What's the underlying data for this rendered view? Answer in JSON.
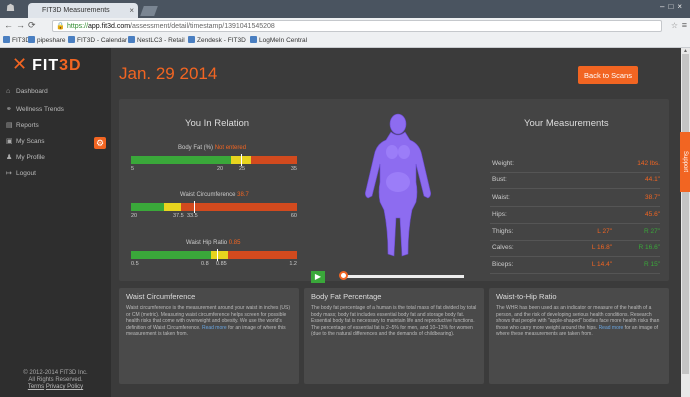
{
  "browser": {
    "tab_title": "FIT3D Measurements",
    "url_scheme": "https://",
    "url_host": "app.fit3d.com",
    "url_path": "/assessment/detail/timestamp/1391041545208",
    "bookmarks": [
      "FIT3D",
      "pipeshare",
      "FIT3D - Calendar",
      "NestLC3 - Retail",
      "Zendesk - FIT3D",
      "LogMeIn Central"
    ]
  },
  "sidebar": {
    "logo_text": "FIT",
    "logo_accent": "3D",
    "items": [
      {
        "label": "Dashboard",
        "icon": "home-icon"
      },
      {
        "label": "Wellness Trends",
        "icon": "trends-icon"
      },
      {
        "label": "Reports",
        "icon": "reports-icon"
      },
      {
        "label": "My Scans",
        "icon": "scans-icon"
      },
      {
        "label": "My Profile",
        "icon": "profile-icon"
      },
      {
        "label": "Logout",
        "icon": "logout-icon"
      }
    ],
    "copyright_line1": "© 2012-2014 FIT3D Inc.",
    "copyright_line2": "All Rights Reserved.",
    "terms": "Terms",
    "privacy": "Privacy Policy"
  },
  "header": {
    "date": "Jan. 29 2014",
    "back_button": "Back to Scans"
  },
  "relation": {
    "heading": "You In Relation",
    "metrics": [
      {
        "label": "Body Fat (%)",
        "value": "Not entered",
        "fill": {
          "green": 0.6,
          "yellow": 0.12,
          "red": 0.28
        },
        "marker": 0.66,
        "ticks": [
          "5",
          "20",
          "25",
          "35"
        ]
      },
      {
        "label": "Waist Circumference",
        "value": "38.7",
        "fill": {
          "green": 0.2,
          "yellow": 0.1,
          "red": 0.7
        },
        "marker": 0.38,
        "ticks": [
          "20",
          "37.5",
          "33.5",
          "60"
        ]
      },
      {
        "label": "Waist Hip Ratio",
        "value": "0.85",
        "fill": {
          "green": 0.48,
          "yellow": 0.1,
          "red": 0.42
        },
        "marker": 0.52,
        "ticks": [
          "0.5",
          "0.8",
          "0.85",
          "1.2"
        ]
      }
    ]
  },
  "measurements": {
    "heading": "Your Measurements",
    "rows": [
      {
        "label": "Weight:",
        "left": "",
        "right": "142 lbs."
      },
      {
        "label": "Bust:",
        "left": "",
        "right": "44.1\""
      },
      {
        "label": "Waist:",
        "left": "",
        "right": "38.7\""
      },
      {
        "label": "Hips:",
        "left": "",
        "right": "45.6\""
      },
      {
        "label": "Thighs:",
        "left": "L 27\"",
        "right": "R 27\""
      },
      {
        "label": "Calves:",
        "left": "L 16.8\"",
        "right": "R 16.6\""
      },
      {
        "label": "Biceps:",
        "left": "L 14.4\"",
        "right": "R 15\""
      }
    ]
  },
  "support_label": "Support",
  "info_cards": [
    {
      "title": "Waist Circumference",
      "text": "Waist circumference is the measurement around your waist in inches (US) or CM (metric). Measuring waist circumference helps screen for possible health risks that come with overweight and obesity. We use the world's definition of Waist Circumference.",
      "link": "Read more",
      "tail": " for an image of where this measurement is taken from."
    },
    {
      "title": "Body Fat Percentage",
      "text": "The body fat percentage of a human is the total mass of fat divided by total body mass; body fat includes essential body fat and storage body fat. Essential body fat is necessary to maintain life and reproductive functions. The percentage of essential fat is 2–5% for men, and 10–13% for women (due to the natural differences and the demands of childbearing).",
      "link": "",
      "tail": ""
    },
    {
      "title": "Waist-to-Hip Ratio",
      "text": "The WHR has been used as an indicator or measure of the health of a person, and the risk of developing serious health conditions. Research shows that people with \"apple-shaped\" bodies face more health risks than those who carry more weight around the hips.",
      "link": "Read more",
      "tail": " for an image of where these measurements are taken from."
    }
  ]
}
